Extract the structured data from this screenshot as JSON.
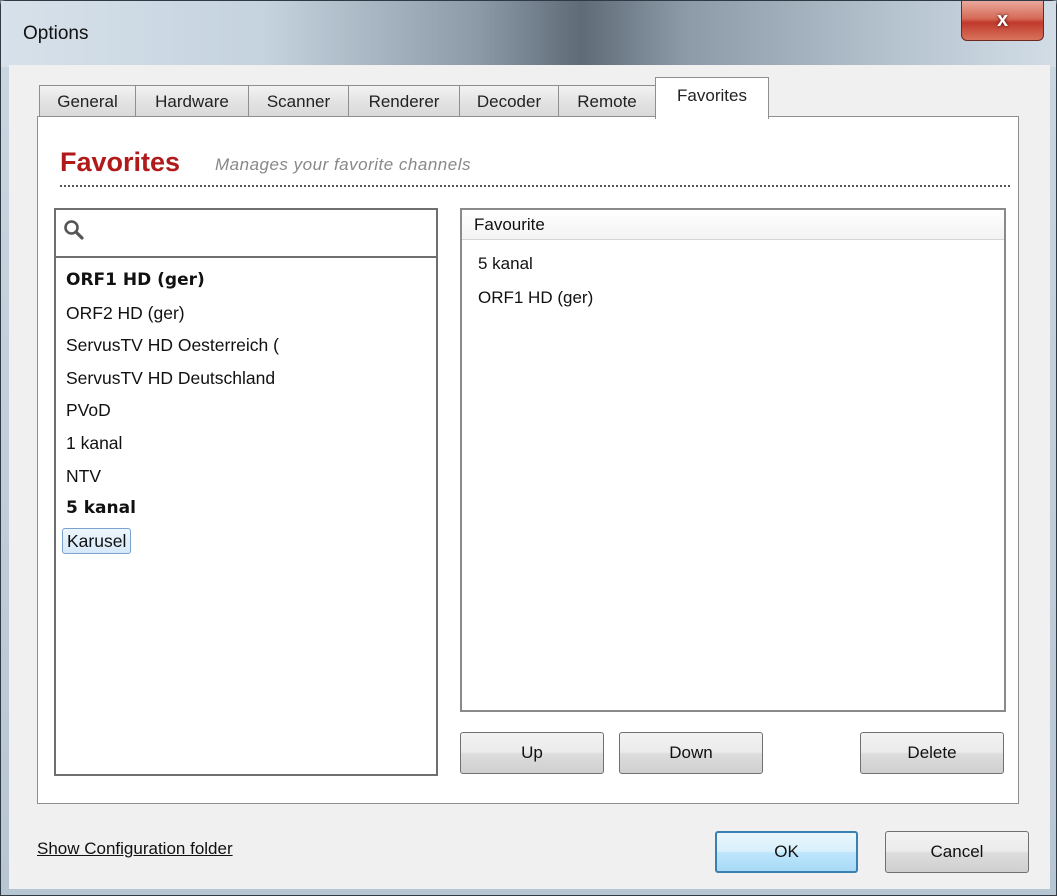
{
  "window": {
    "title": "Options",
    "close_label": "x"
  },
  "tabs": [
    {
      "label": "General"
    },
    {
      "label": "Hardware"
    },
    {
      "label": "Scanner"
    },
    {
      "label": "Renderer"
    },
    {
      "label": "Decoder"
    },
    {
      "label": "Remote"
    },
    {
      "label": "Favorites",
      "active": true
    }
  ],
  "header": {
    "title": "Favorites",
    "subtitle": "Manages your favorite channels"
  },
  "search": {
    "icon": "search-icon",
    "value": "",
    "placeholder": ""
  },
  "channels": [
    {
      "label": "ORF1 HD (ger)",
      "bold": true
    },
    {
      "label": "ORF2 HD (ger)"
    },
    {
      "label": "ServusTV HD Oesterreich ("
    },
    {
      "label": "ServusTV HD Deutschland"
    },
    {
      "label": "PVoD"
    },
    {
      "label": "1 kanal"
    },
    {
      "label": "NTV"
    },
    {
      "label": "5 kanal",
      "bold": true
    },
    {
      "label": "Karusel",
      "selected": true
    }
  ],
  "favourites": {
    "column_header": "Favourite",
    "items": [
      "5 kanal",
      "ORF1 HD (ger)"
    ]
  },
  "buttons": {
    "up": "Up",
    "down": "Down",
    "delete": "Delete",
    "ok": "OK",
    "cancel": "Cancel"
  },
  "footer": {
    "config_link": "Show Configuration folder"
  }
}
